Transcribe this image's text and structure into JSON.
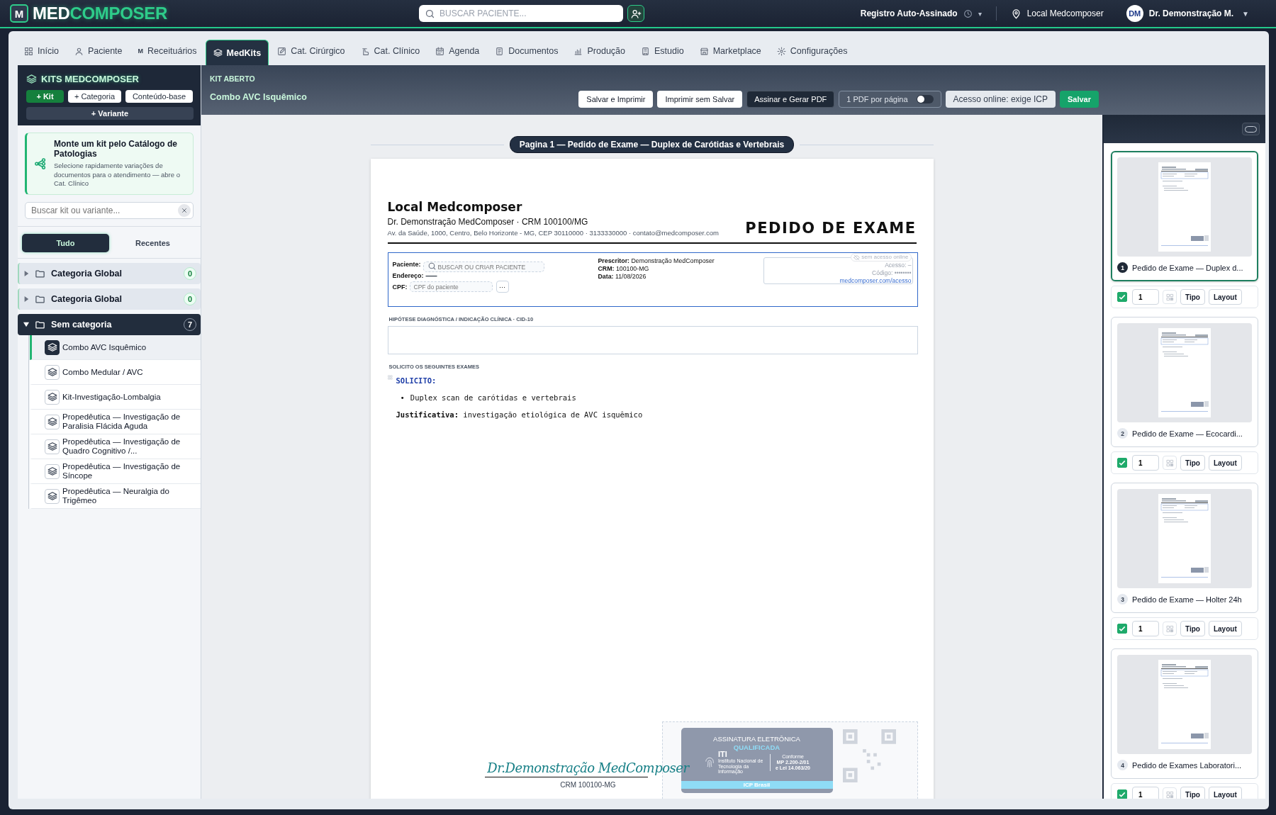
{
  "topbar": {
    "logo_mark": "M",
    "brand": [
      "MED",
      "COMPOSER"
    ],
    "search": {
      "placeholder": "BUSCAR PACIENTE..."
    },
    "registro": "Registro Auto-Assinado",
    "registro_caret": "▾",
    "location": "Local Medcomposer",
    "user": {
      "initials": "DM",
      "name": "Dr. Demonstração M.",
      "caret": "▼"
    }
  },
  "tabs": [
    {
      "label": "Início",
      "selected": false
    },
    {
      "label": "Paciente",
      "selected": false
    },
    {
      "label": "Receituários",
      "icon_char": "M",
      "selected": false
    },
    {
      "label": "MedKits",
      "selected": true
    },
    {
      "label": "Cat. Cirúrgico",
      "selected": false
    },
    {
      "label": "Cat. Clínico",
      "selected": false
    },
    {
      "label": "Agenda",
      "selected": false
    },
    {
      "label": "Documentos",
      "selected": false
    },
    {
      "label": "Produção",
      "selected": false
    },
    {
      "label": "Estudio",
      "selected": false
    },
    {
      "label": "Marketplace",
      "selected": false
    },
    {
      "label": "Configurações",
      "selected": false
    }
  ],
  "sidebar": {
    "title": "KITS MEDCOMPOSER",
    "buttons": [
      {
        "label": "+ Kit",
        "kind": "primary"
      },
      {
        "label": "+ Categoria",
        "kind": "light"
      },
      {
        "label": "Conteúdo-base",
        "kind": "light"
      },
      {
        "label": "+ Variante",
        "kind": "wide"
      }
    ],
    "promo": {
      "title": "Monte um kit pelo Catálogo de Patologias",
      "text": "Selecione rapidamente variações de documentos para o atendimento — abre o Cat. Clínico"
    },
    "search": {
      "placeholder": "Buscar kit ou variante..."
    },
    "filters": [
      {
        "label": "Tudo",
        "selected": true
      },
      {
        "label": "Recentes",
        "selected": false
      }
    ],
    "categories": [
      {
        "name": "Categoria Global",
        "count": "0",
        "expanded": false
      },
      {
        "name": "Categoria Global",
        "count": "0",
        "expanded": false
      },
      {
        "name": "Sem categoria",
        "count": "7",
        "expanded": true,
        "children": [
          {
            "name": "Combo AVC Isquêmico",
            "selected": true
          },
          {
            "name": "Combo Medular / AVC",
            "selected": false
          },
          {
            "name": "Kit-Investigação-Lombalgia",
            "selected": false
          },
          {
            "name": "Propedêutica — Investigação de Paralisia Flácida Aguda",
            "selected": false
          },
          {
            "name": "Propedêutica — Investigação de Quadro Cognitivo /...",
            "selected": false
          },
          {
            "name": "Propedêutica — Investigação de Síncope",
            "selected": false
          },
          {
            "name": "Propedêutica — Neuralgia do Trigêmeo",
            "selected": false
          }
        ]
      }
    ]
  },
  "kit_header": {
    "label": "KIT ABERTO",
    "name": "Combo AVC Isquêmico",
    "actions": [
      {
        "label": "Salvar e Imprimir",
        "kind": "light"
      },
      {
        "label": "Imprimir sem Salvar",
        "kind": "light"
      },
      {
        "label": "Assinar e Gerar PDF",
        "kind": "dark"
      }
    ],
    "per_page_toggle": {
      "label": "1 PDF por página",
      "on": false
    },
    "access_button": "Acesso online: exige ICP",
    "save_button": "Salvar"
  },
  "document": {
    "page_label": "Pagina 1 — Pedido de Exame — Duplex de Carótidas e Vertebrais",
    "clinic": "Local Medcomposer",
    "doctor_line": "Dr. Demonstração MedComposer · CRM 100100/MG",
    "address": "Av. da Saúde, 1000, Centro, Belo Horizonte - MG, CEP 30110000 · 3133330000 · contato@medcomposer.com",
    "doc_title": "PEDIDO DE EXAME",
    "patient": {
      "patient_label": "Paciente:",
      "patient_placeholder": "BUSCAR OU CRIAR PACIENTE",
      "address_label": "Endereço:",
      "address_value": "—",
      "cpf_label": "CPF:",
      "cpf_placeholder": "CPF do paciente",
      "more": "···"
    },
    "prescriber": [
      "**Prescritor:** Demonstração MedComposer",
      "**CRM:** 100100-MG",
      "**Data:** 11/08/2026"
    ],
    "access": {
      "badge": "sem acesso online",
      "lines": [
        "Acesso: –",
        "Código: ••••••••"
      ],
      "link": "medcomposer.com/acesso"
    },
    "hypothesis_label": "HIPÓTESE DIAGNÓSTICA / INDICAÇÃO CLÍNICA · CID-10",
    "exams_label": "SOLICITO OS SEGUINTES EXAMES",
    "body": {
      "heading": "SOLICITO:",
      "bullet": "•",
      "items": [
        "Duplex scan de carótidas e vertebrais"
      ],
      "justification": "**Justificativa:** investigação etiológica de AVC isquêmico"
    },
    "signature": {
      "name": "Dr.Demonstração MedComposer",
      "crm": "CRM 100100-MG"
    },
    "stamp": {
      "line1": "ASSINATURA ELETRÔNICA",
      "line2": "QUALIFICADA",
      "iti": "ITI",
      "iti_caption": "Instituto Nacional de Tecnologia da Informação",
      "conform": [
        "Conforme",
        "MP 2.200-2/01",
        "e Lei 14.063/20"
      ],
      "icp": "ICP Brasil"
    }
  },
  "pages_panel": {
    "view_toggle_on": false,
    "pages": [
      {
        "number": "1",
        "title": "Pedido de Exame — Duplex d...",
        "selected": true,
        "included": true,
        "copies": "1",
        "buttons": [
          "Tipo",
          "Layout"
        ]
      },
      {
        "number": "2",
        "title": "Pedido de Exame — Ecocardi...",
        "selected": false,
        "included": true,
        "copies": "1",
        "buttons": [
          "Tipo",
          "Layout"
        ]
      },
      {
        "number": "3",
        "title": "Pedido de Exame — Holter 24h",
        "selected": false,
        "included": true,
        "copies": "1",
        "buttons": [
          "Tipo",
          "Layout"
        ]
      },
      {
        "number": "4",
        "title": "Pedido de Exames Laboratori...",
        "selected": false,
        "included": true,
        "copies": "1",
        "buttons": [
          "Tipo",
          "Layout"
        ]
      }
    ]
  }
}
